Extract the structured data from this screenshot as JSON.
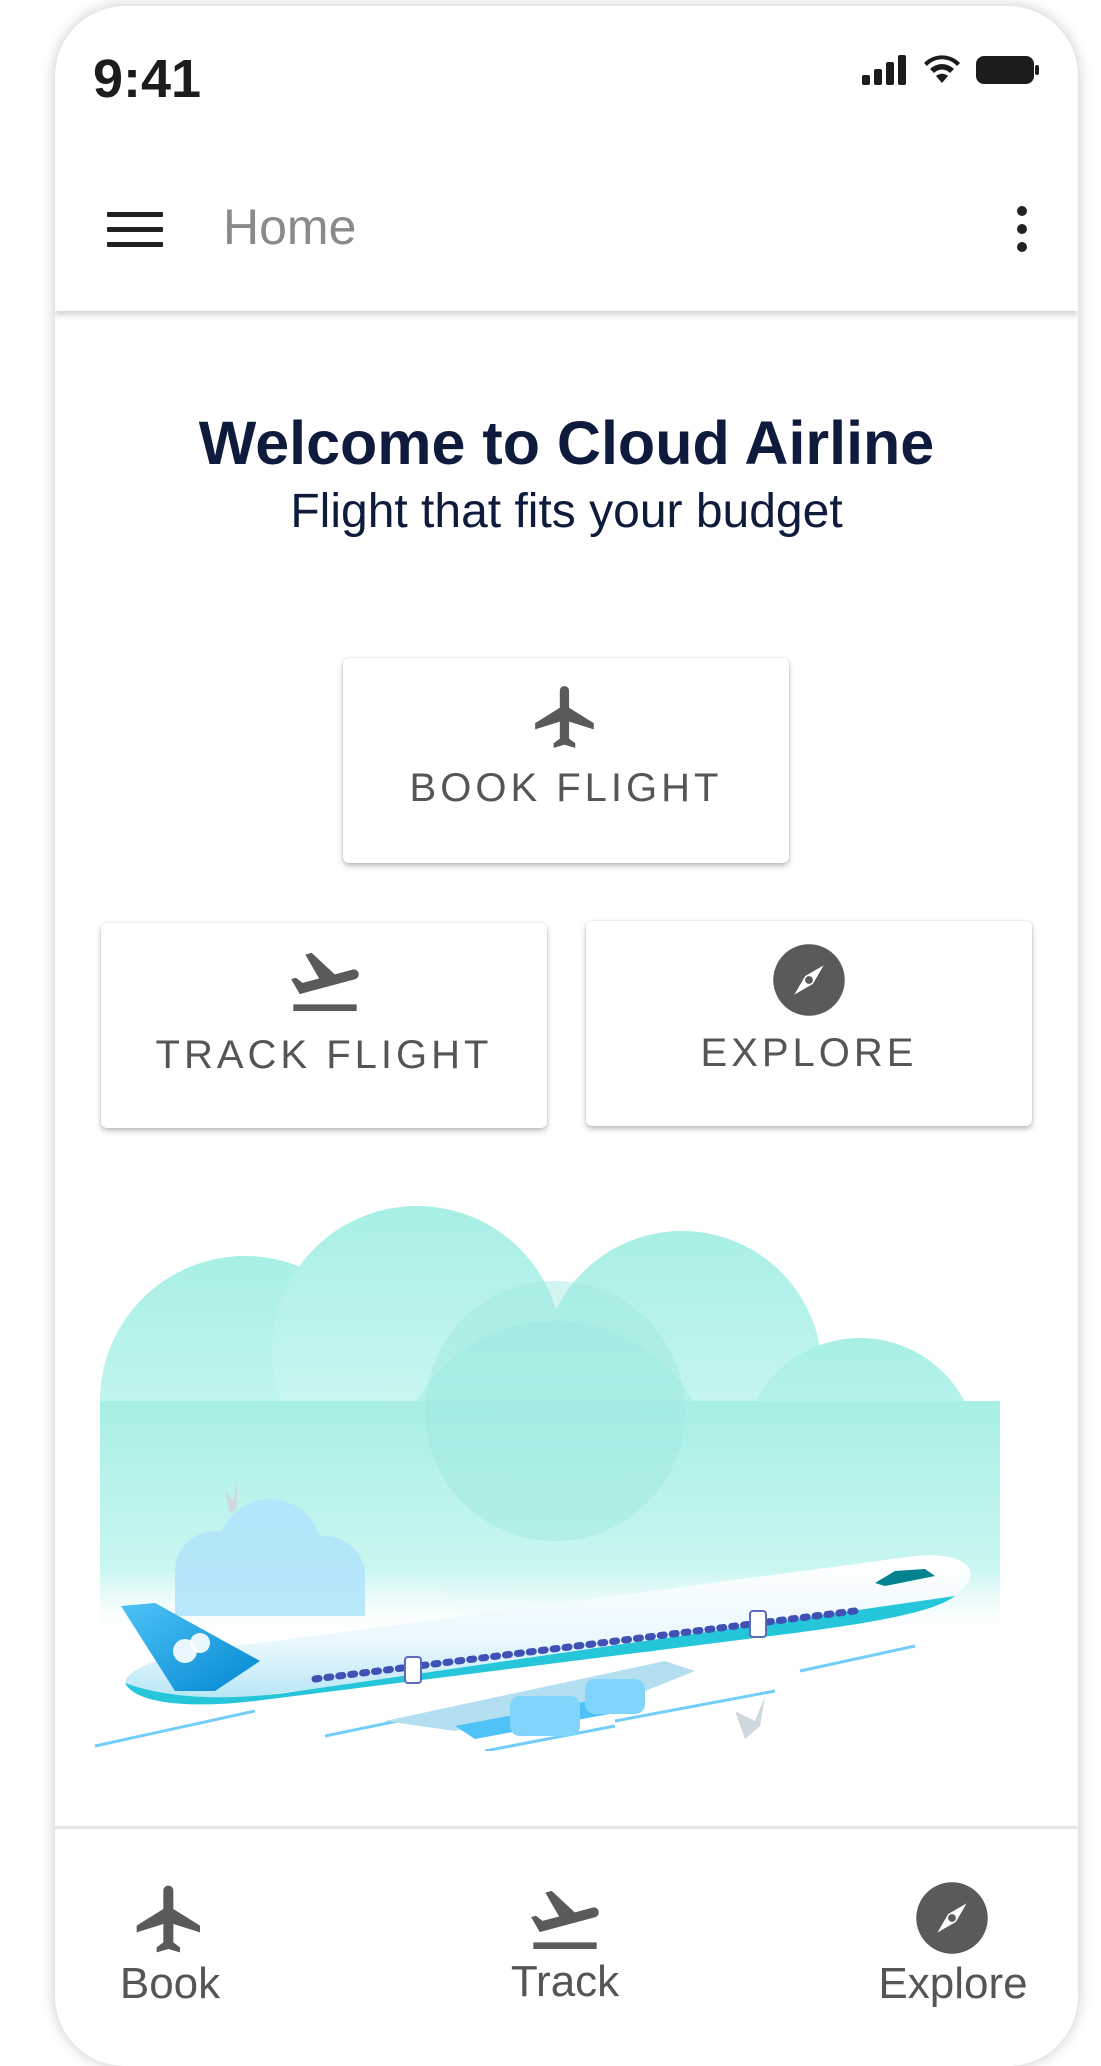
{
  "status_bar": {
    "time": "9:41"
  },
  "app_bar": {
    "title": "Home"
  },
  "welcome": {
    "title": "Welcome to Cloud Airline",
    "subtitle": "Flight that fits your budget"
  },
  "actions": {
    "book": {
      "label": "BOOK FLIGHT",
      "icon": "airplane-icon"
    },
    "track": {
      "label": "TRACK FLIGHT",
      "icon": "flight-takeoff-icon"
    },
    "explore": {
      "label": "EXPLORE",
      "icon": "compass-icon"
    }
  },
  "bottom_nav": {
    "items": [
      {
        "label": "Book",
        "icon": "airplane-icon"
      },
      {
        "label": "Track",
        "icon": "flight-takeoff-icon"
      },
      {
        "label": "Explore",
        "icon": "compass-icon"
      }
    ]
  },
  "colors": {
    "title_text": "#0f1b3d",
    "icon_gray": "#5a5a5a",
    "cloud": "#aef0ea",
    "plane_blue": "#29b6f6"
  }
}
